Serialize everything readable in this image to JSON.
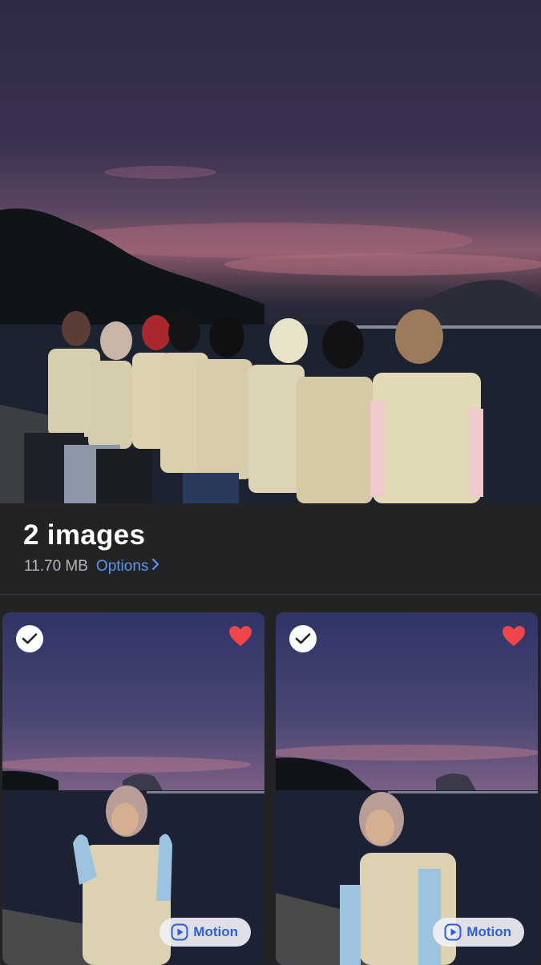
{
  "album": {
    "count_label": "2 images",
    "size_label": "11.70 MB",
    "options_label": "Options"
  },
  "tiles": [
    {
      "motion_label": "Motion",
      "selected": true,
      "favorite": true
    },
    {
      "motion_label": "Motion",
      "selected": true,
      "favorite": true
    }
  ],
  "icons": {
    "check": "check-icon",
    "heart": "heart-icon",
    "motion": "play-circle-icon",
    "chevron": "chevron-right-icon"
  },
  "colors": {
    "background": "#232326",
    "accent": "#5a96ee",
    "heart": "#f0464a",
    "motion_text": "#2d5fd6"
  }
}
